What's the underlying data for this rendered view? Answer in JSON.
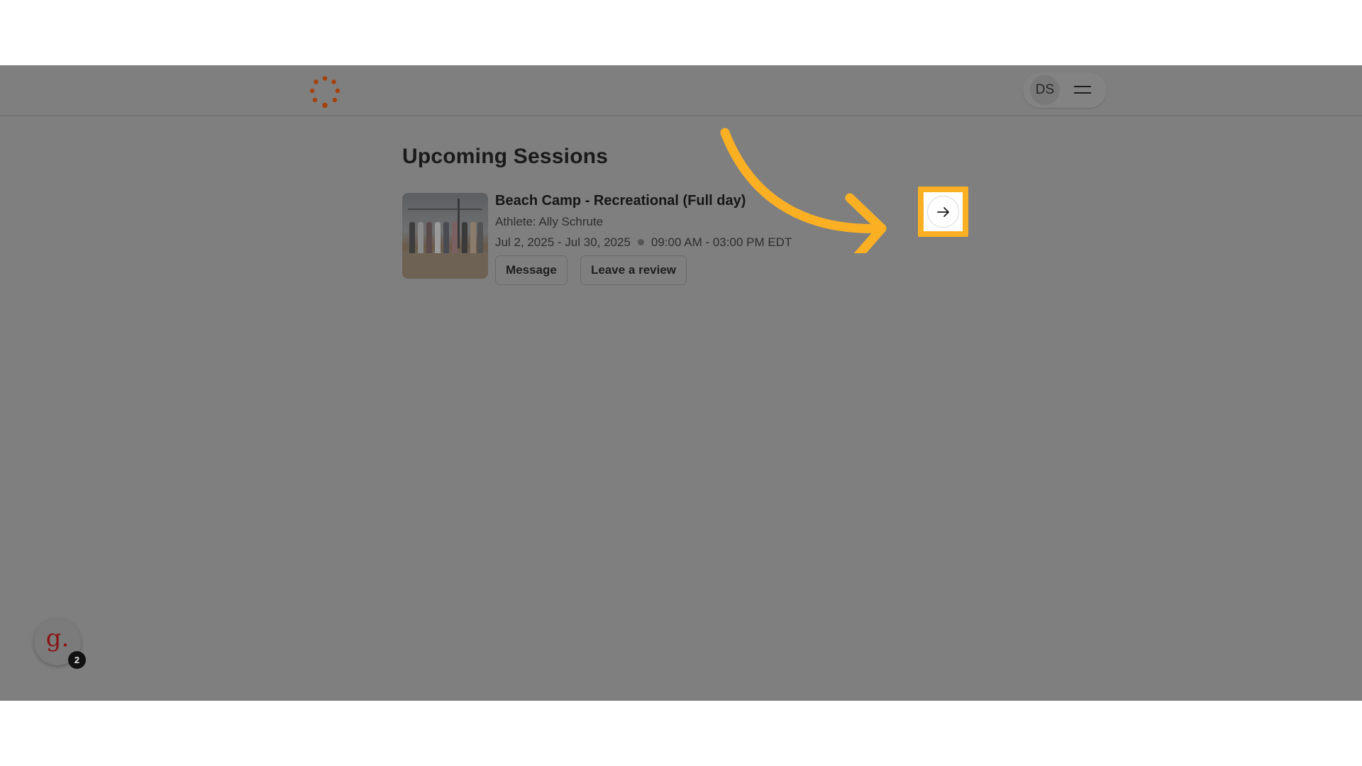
{
  "header": {
    "logo_icon": "dotted-circle-logo-icon",
    "logo_color": "#a5410c",
    "user_initials": "DS",
    "menu_icon": "hamburger-menu-icon"
  },
  "main": {
    "title": "Upcoming Sessions",
    "sessions": [
      {
        "name": "Beach Camp - Recreational (Full day)",
        "athlete": "Athlete: Ally Schrute",
        "dates": "Jul 2, 2025 - Jul 30, 2025",
        "times": "09:00 AM - 03:00 PM EDT",
        "actions": [
          "Message",
          "Leave a review"
        ],
        "open_icon": "arrow-right-icon"
      }
    ]
  },
  "annotation": {
    "highlight_color": "#fbb023",
    "callout_icon": "curved-arrow-icon"
  },
  "assistant": {
    "glyph": "g.",
    "badge_count": "2"
  }
}
